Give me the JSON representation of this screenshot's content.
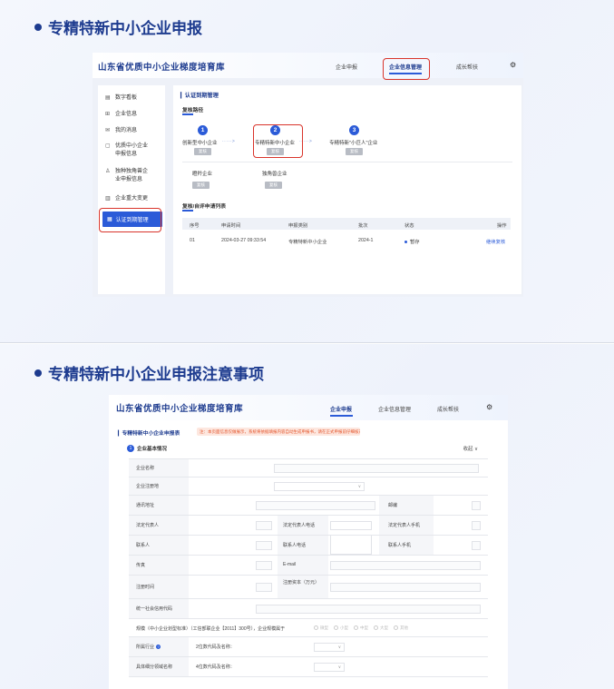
{
  "slide1": {
    "title": "专精特新中小企业申报",
    "app": {
      "brand": "山东省优质中小企业梯度培育库",
      "nav": [
        "企业申报",
        "企业信息管理",
        "成长帮扶"
      ],
      "active_nav": "企业信息管理",
      "sidebar": [
        {
          "icon": "▤",
          "label": "数字看板"
        },
        {
          "icon": "⊞",
          "label": "企业信息"
        },
        {
          "icon": "✉",
          "label": "我的消息"
        },
        {
          "icon": "▢",
          "label": "优质中小企业",
          "label2": "申报信息"
        },
        {
          "icon": "♙",
          "label": "独种独角兽企",
          "label2": "业申报信息"
        },
        {
          "icon": "▥",
          "label": "企业重大变更"
        }
      ],
      "sidebar_active": {
        "icon": "▦",
        "label": "认证到期管理"
      },
      "main": {
        "section_title": "认证到期管理",
        "path_title": "复核路径",
        "steps": [
          {
            "num": "1",
            "label": "创新型中小企业",
            "btn": "复核"
          },
          {
            "num": "2",
            "label": "专精特新中小企业",
            "btn": "复核"
          },
          {
            "num": "3",
            "label": "专精特新\"小巨人\"企业",
            "btn": "复核"
          }
        ],
        "arrow": "·····>",
        "extra": [
          {
            "label": "瞪羚企业",
            "btn": "复核"
          },
          {
            "label": "独角兽企业",
            "btn": "复核"
          }
        ],
        "list_title": "复核/自评申请列表",
        "table": {
          "headers": [
            "序号",
            "申请时间",
            "申报类别",
            "批次",
            "状态",
            "操作"
          ],
          "rows": [
            {
              "no": "01",
              "time": "2024-03-27 09:33:54",
              "type": "专精特新中小企业",
              "batch": "2024-1",
              "status": "暂存",
              "action": "继续复核"
            }
          ]
        }
      }
    }
  },
  "slide2": {
    "title": "专精特新中小企业申报注意事项",
    "app": {
      "brand": "山东省优质中小企业梯度培育库",
      "nav": [
        "企业申报",
        "企业信息管理",
        "成长帮扶"
      ],
      "active_nav": "企业申报",
      "form_title": "专精特新中小企业申报表",
      "warning": "注：本页面信息仅做展示，系统将依据填报内容自动生成申报书，请在正式申报前仔细核对",
      "section": {
        "num": "1",
        "title": "企业基本情况",
        "collapse": "收起 ∨"
      },
      "fields": {
        "company_name": "企业名称",
        "reg_place": "企业注册地",
        "address": "通讯地址",
        "postcode": "邮编",
        "legal_rep": "法定代表人",
        "legal_phone": "法定代表人电话",
        "legal_mobile": "法定代表人手机",
        "contact": "联系人",
        "contact_phone": "联系人电话",
        "contact_mobile": "联系人手机",
        "fax": "传真",
        "email": "E-mail",
        "reg_time": "注册时间",
        "reg_capital": "注册资本（万元）",
        "credit_code": "统一社会信用代码",
        "scale_label": "规模（中小企业划型标准）（工信部联企业【2011】300号），企业规模属于",
        "industry": "所属行业",
        "industry_sub": "2位数代码及名称：",
        "main_product": "具体细分领域名称",
        "main_product_sub": "4位数代码及名称："
      },
      "scale_options": [
        "微型",
        "小型",
        "中型",
        "大型",
        "其他"
      ]
    }
  }
}
